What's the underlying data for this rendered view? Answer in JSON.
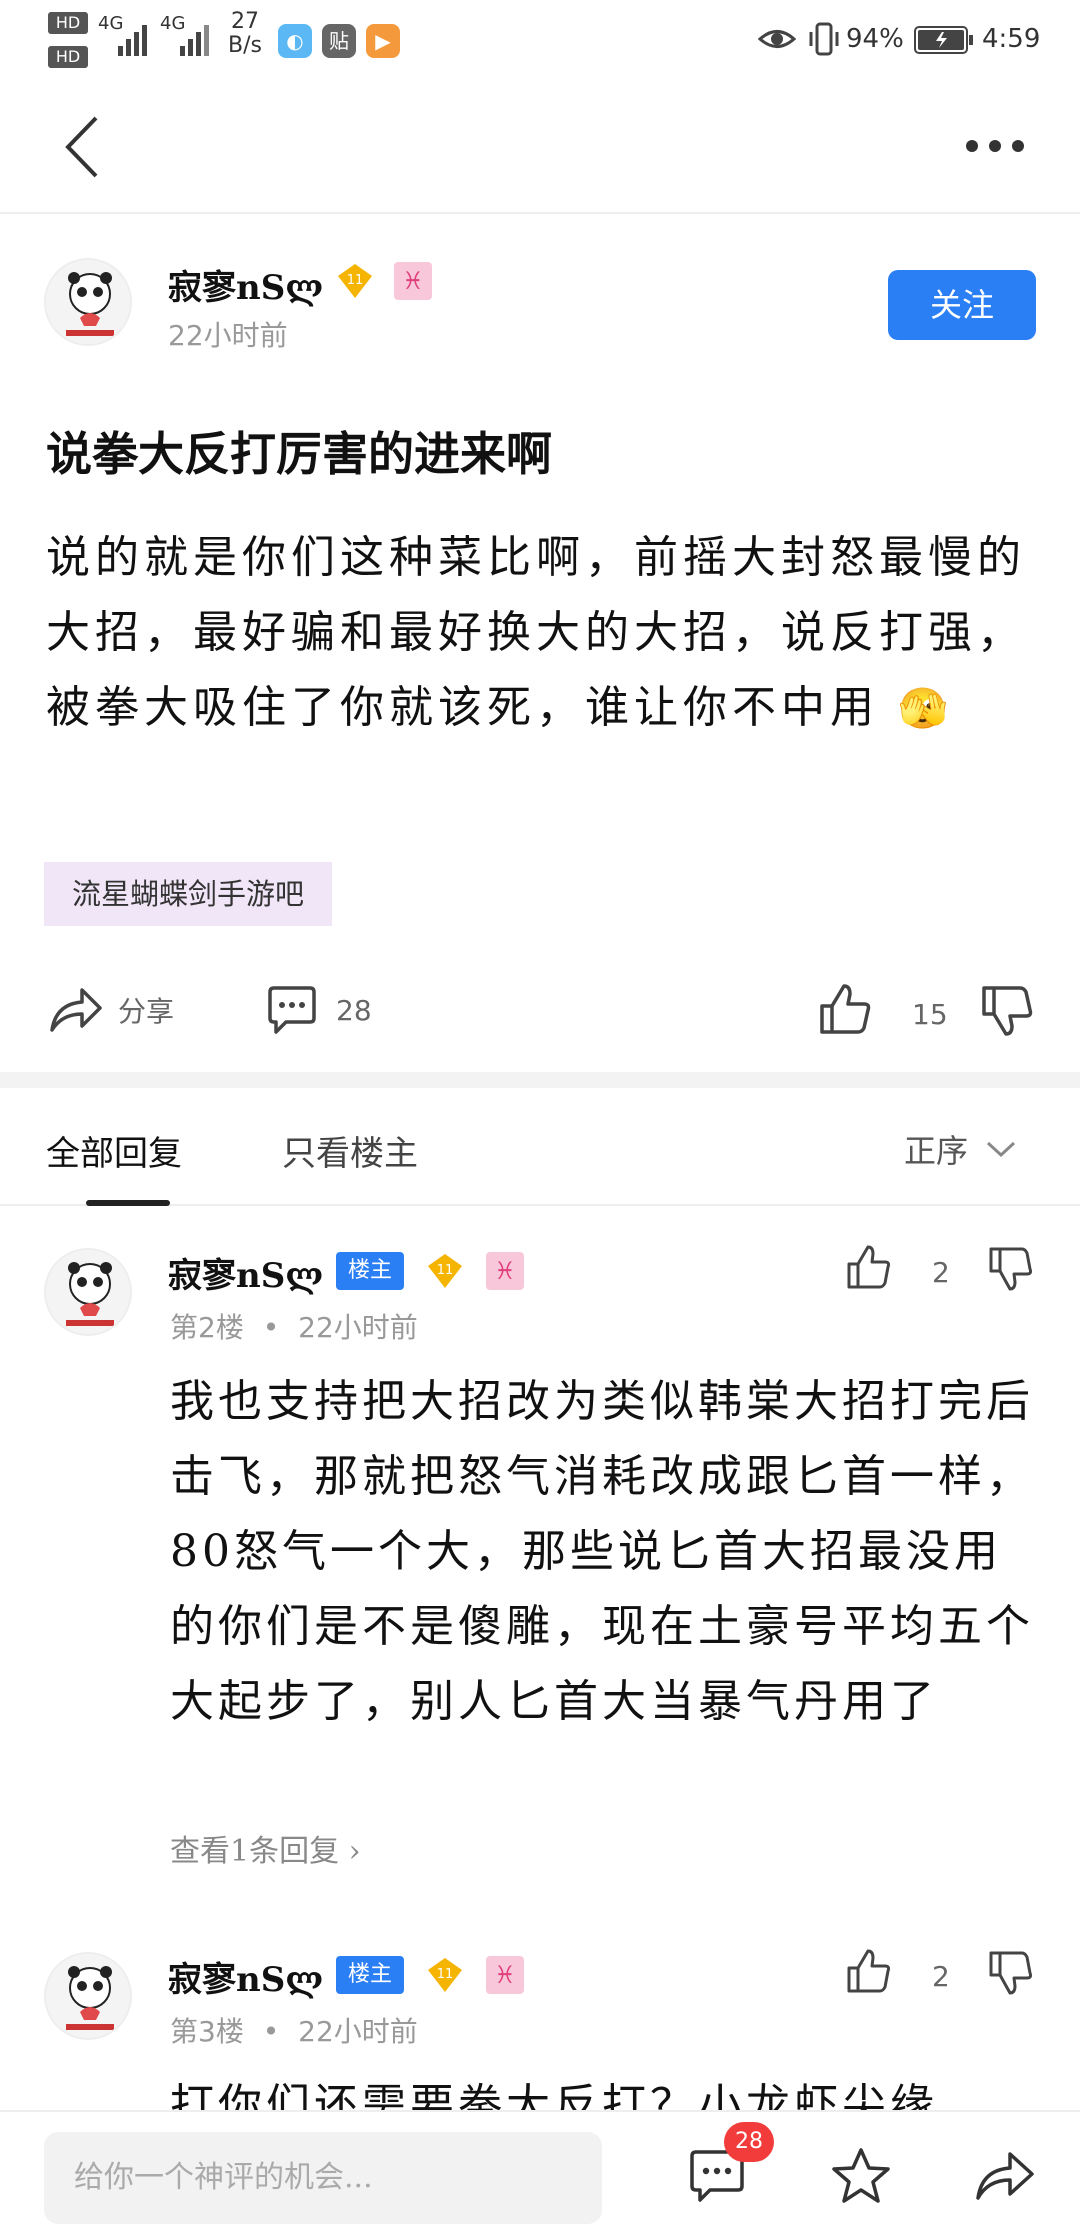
{
  "status_bar": {
    "net_speed_value": "27",
    "net_speed_unit": "B/s",
    "hd1": "HD",
    "hd2": "HD",
    "sig1": "4G",
    "sig2": "4G",
    "app_icon_3": "贴",
    "battery": "94%",
    "time": "4:59"
  },
  "post": {
    "author": "寂寥nSლ",
    "level": "11",
    "time": "22小时前",
    "follow_label": "关注",
    "title": "说拳大反打厉害的进来啊",
    "body": "说的就是你们这种菜比啊，前摇大封怒最慢的大招，最好骗和最好换大的大招，说反打强，被拳大吸住了你就该死，谁让你不中用",
    "emoji": "🫣",
    "forum_tag": "流星蝴蝶剑手游吧",
    "share_label": "分享",
    "comments_count": "28",
    "likes_count": "15"
  },
  "tabs": {
    "all": "全部回复",
    "owner_only": "只看楼主",
    "order": "正序"
  },
  "replies": [
    {
      "author": "寂寥nSლ",
      "owner_badge": "楼主",
      "level": "11",
      "floor": "第2楼",
      "time": "22小时前",
      "likes": "2",
      "text": "我也支持把大招改为类似韩棠大招打完后击飞，那就把怒气消耗改成跟匕首一样，80怒气一个大，那些说匕首大招最没用的你们是不是傻雕，现在土豪号平均五个大起步了，别人匕首大当暴气丹用了",
      "view_replies": "查看1条回复"
    },
    {
      "author": "寂寥nSლ",
      "owner_badge": "楼主",
      "level": "11",
      "floor": "第3楼",
      "time": "22小时前",
      "likes": "2",
      "text": "打你们还需要拳大反打？小龙虾尖缘"
    }
  ],
  "bottom_bar": {
    "input_placeholder": "给你一个神评的机会...",
    "comment_badge": "28"
  },
  "colors": {
    "accent": "#2a7ff5",
    "tag_bg": "#f0e6f7",
    "badge_red": "#f23c3c",
    "gem": "#f5b400"
  }
}
